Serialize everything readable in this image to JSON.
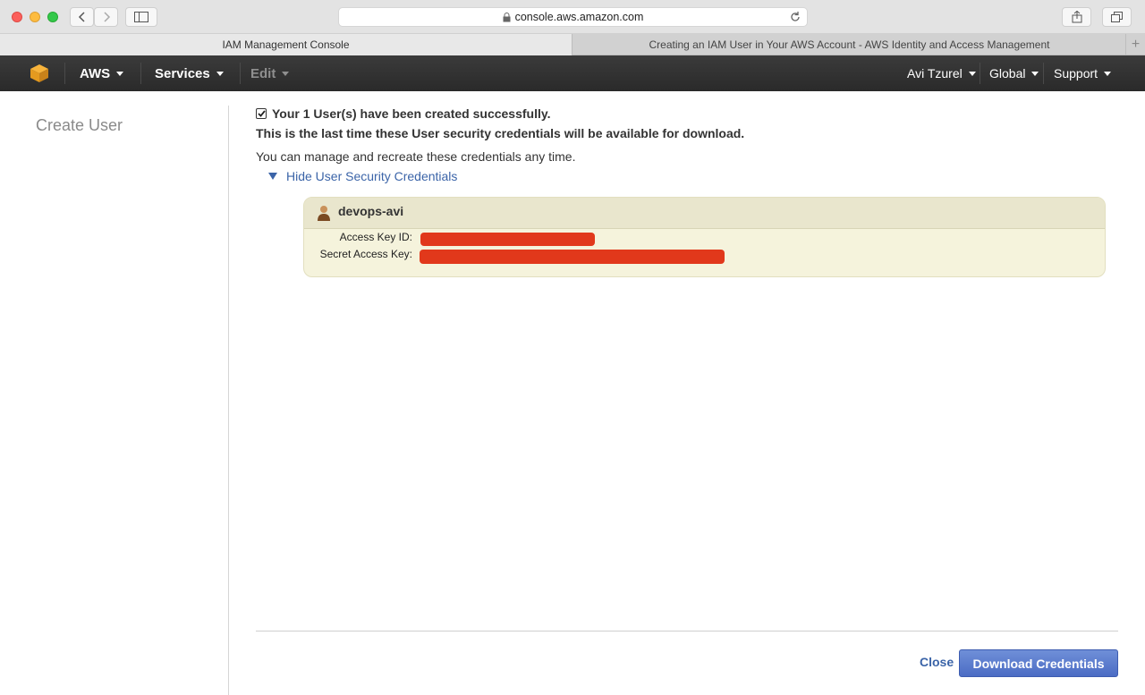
{
  "browser": {
    "url": "console.aws.amazon.com",
    "tabs": [
      {
        "label": "IAM Management Console"
      },
      {
        "label": "Creating an IAM User in Your AWS Account - AWS Identity and Access Management"
      }
    ],
    "new_tab": "+"
  },
  "aws_nav": {
    "brand": "AWS",
    "services": "Services",
    "edit": "Edit",
    "user": "Avi Tzurel",
    "region": "Global",
    "support": "Support"
  },
  "sidebar": {
    "title": "Create User"
  },
  "main": {
    "success_message": "Your 1 User(s) have been created successfully.",
    "last_time_message": "This is the last time these User security credentials will be available for download.",
    "manage_message": "You can manage and recreate these credentials any time.",
    "hide_link": "Hide User Security Credentials",
    "credentials": {
      "username": "devops-avi",
      "access_key_label": "Access Key ID:",
      "secret_key_label": "Secret Access Key:"
    }
  },
  "footer": {
    "close": "Close",
    "download": "Download Credentials"
  },
  "colors": {
    "link": "#3b64a8",
    "redaction": "#e1381b",
    "primary_button": "#4b6cc4"
  }
}
